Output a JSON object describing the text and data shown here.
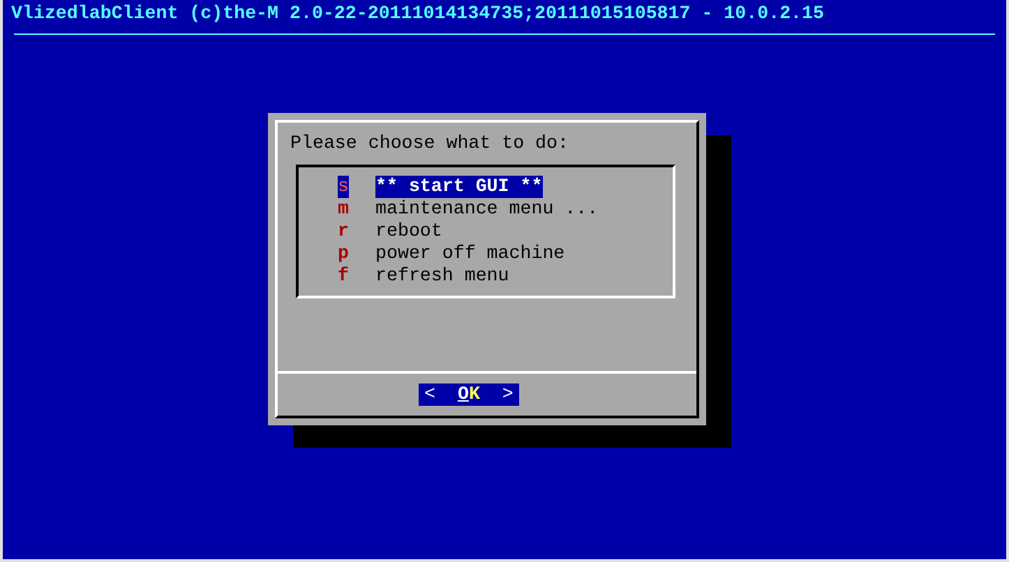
{
  "backtitle": "VlizedlabClient (c)the-M 2.0-22-20111014134735;20111015105817 - 10.0.2.15",
  "dialog": {
    "prompt": "Please choose what to do:",
    "items": [
      {
        "key": "s",
        "label": "** start GUI **",
        "selected": true
      },
      {
        "key": "m",
        "label": "maintenance menu ...",
        "selected": false
      },
      {
        "key": "r",
        "label": "reboot",
        "selected": false
      },
      {
        "key": "p",
        "label": "power off machine",
        "selected": false
      },
      {
        "key": "f",
        "label": "refresh menu",
        "selected": false
      }
    ],
    "button": {
      "open": "<",
      "label": "OK",
      "close": ">",
      "selected": true
    }
  }
}
